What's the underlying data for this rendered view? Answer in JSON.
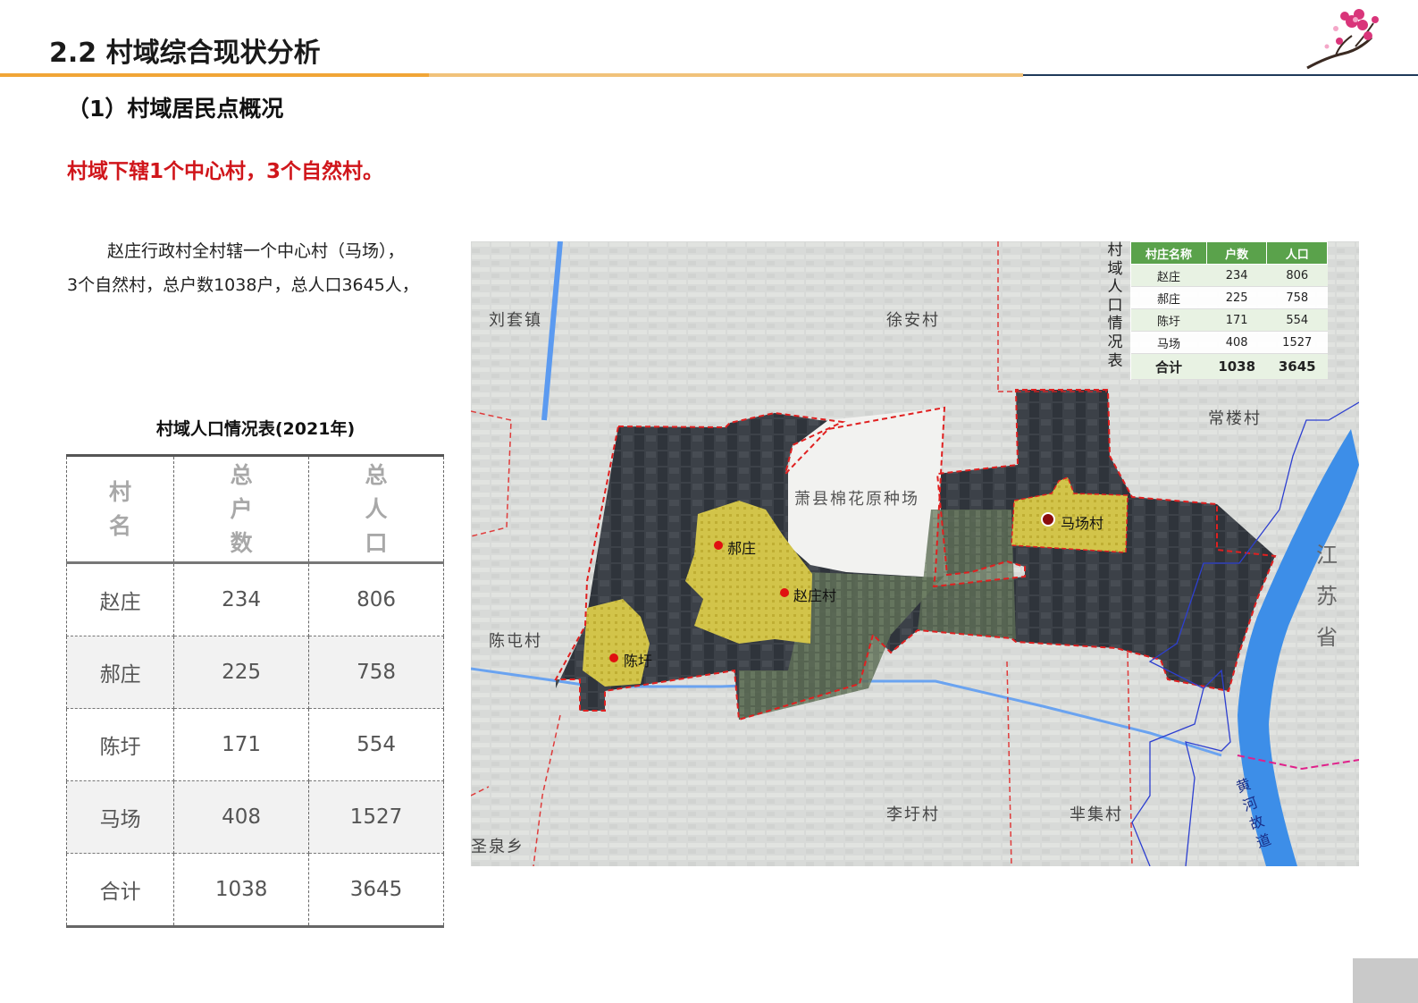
{
  "header": {
    "title": "2.2 村域综合现状分析",
    "section": "（1）村域居民点概况",
    "highlight": "村域下辖1个中心村，3个自然村。"
  },
  "body": {
    "line1": "赵庄行政村全村辖一个中心村（马场），",
    "line2": "3个自然村，总户数1038户，总人口3645人，"
  },
  "table": {
    "caption": "村域人口情况表(2021年)",
    "headers": [
      "村名",
      "总户数",
      "总人口"
    ],
    "rows": [
      [
        "赵庄",
        "234",
        "806"
      ],
      [
        "郝庄",
        "225",
        "758"
      ],
      [
        "陈圩",
        "171",
        "554"
      ],
      [
        "马场",
        "408",
        "1527"
      ],
      [
        "合计",
        "1038",
        "3645"
      ]
    ]
  },
  "map": {
    "place_labels": {
      "liutao": "刘套镇",
      "xuan": "徐安村",
      "changlou": "常楼村",
      "farm": "萧县棉花原种场",
      "chentun": "陈屯村",
      "lixu": "李圩村",
      "banji": "芈集村",
      "shengquan": "圣泉乡",
      "jiangsu": "江苏省",
      "river": "黄河故道"
    },
    "village_labels": {
      "machang": "马场村",
      "haozhuang": "郝庄",
      "zhaozhuang": "赵庄村",
      "chenxu": "陈圩"
    },
    "inset": {
      "caption": "村域人口情况表",
      "headers": [
        "村庄名称",
        "户数",
        "人口"
      ],
      "rows": [
        [
          "赵庄",
          "234",
          "806"
        ],
        [
          "郝庄",
          "225",
          "758"
        ],
        [
          "陈圩",
          "171",
          "554"
        ],
        [
          "马场",
          "408",
          "1527"
        ],
        [
          "合计",
          "1038",
          "3645"
        ]
      ]
    },
    "colors": {
      "boundary": "#e02020",
      "settlement": "#d9c84a",
      "water": "#4a8fe0",
      "village_dot": "#e01010",
      "center_dot": "#8a0d0d"
    }
  }
}
